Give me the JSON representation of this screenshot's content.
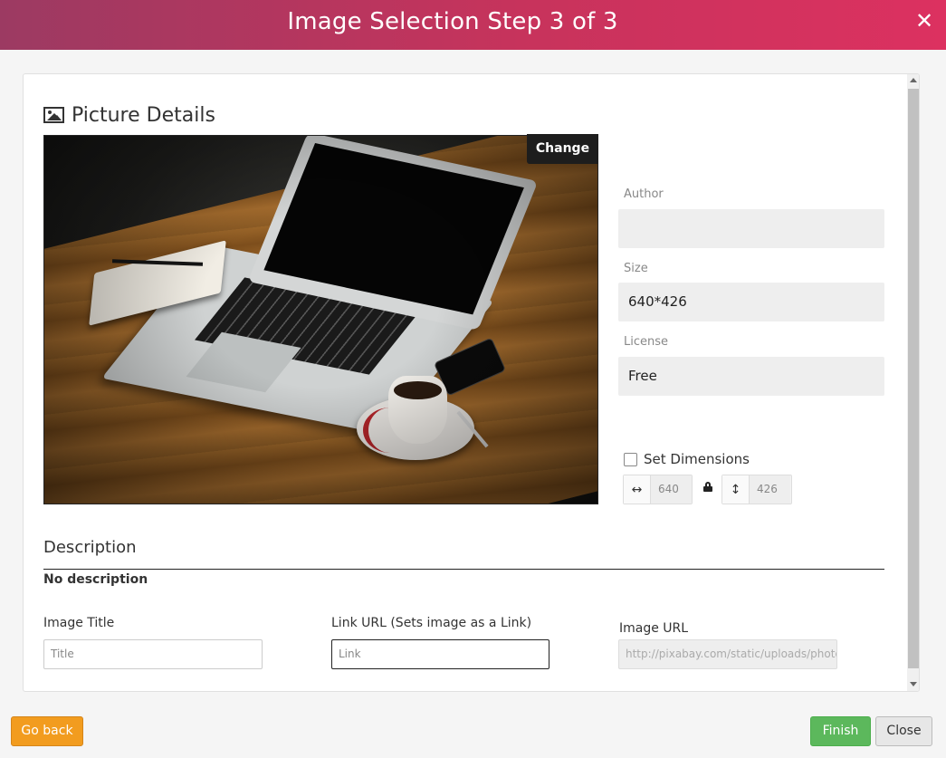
{
  "header": {
    "title": "Image Selection Step 3 of 3",
    "close_symbol": "✕"
  },
  "section": {
    "title": "Picture Details",
    "icon": "picture-icon"
  },
  "photo": {
    "change_label": "Change"
  },
  "details": {
    "author": {
      "label": "Author",
      "value": ""
    },
    "size": {
      "label": "Size",
      "value": "640*426"
    },
    "license": {
      "label": "License",
      "value": "Free"
    }
  },
  "dimensions": {
    "checkbox_label": "Set Dimensions",
    "checked": false,
    "width": "640",
    "height": "426",
    "width_icon": "↔",
    "height_icon": "↕"
  },
  "description": {
    "title": "Description",
    "text": "No description"
  },
  "fields": {
    "image_title": {
      "label": "Image Title",
      "placeholder": "Title"
    },
    "link_url": {
      "label": "Link URL (Sets image as a Link)",
      "placeholder": "Link"
    },
    "image_url": {
      "label": "Image URL",
      "value": "http://pixabay.com/static/uploads/photo"
    }
  },
  "footer": {
    "back_label": "Go back",
    "finish_label": "Finish",
    "close_label": "Close"
  },
  "colors": {
    "header_start": "#9c3a62",
    "header_end": "#dc3160",
    "back": "#f29c1f",
    "finish": "#5cb85c"
  }
}
